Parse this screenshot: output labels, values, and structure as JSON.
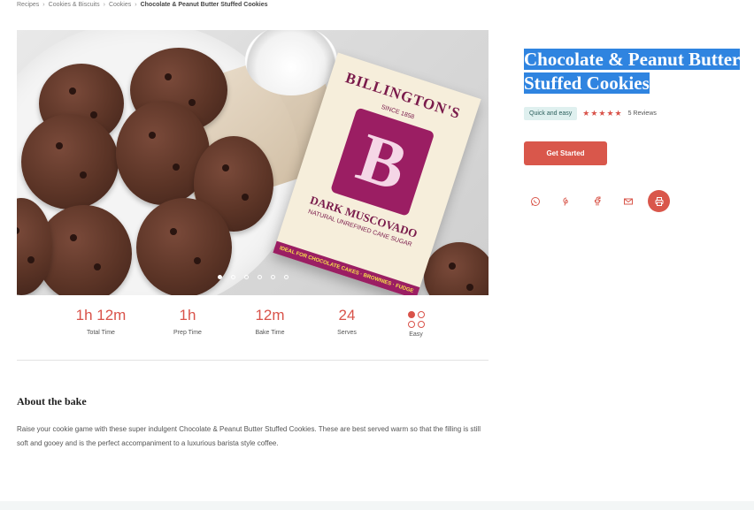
{
  "breadcrumb": {
    "items": [
      "Recipes",
      "Cookies & Biscuits",
      "Cookies"
    ],
    "current": "Chocolate & Peanut Butter Stuffed Cookies"
  },
  "hero": {
    "package": {
      "brand": "BILLINGTON'S",
      "since": "SINCE 1858",
      "letter": "B",
      "variety": "DARK MUSCOVADO",
      "sub": "NATURAL UNREFINED CANE SUGAR",
      "strip": "IDEAL FOR CHOCOLATE CAKES · BROWNIES · FUDGE"
    },
    "carousel": {
      "count": 6,
      "active_index": 0
    }
  },
  "stats": [
    {
      "value": "1h 12m",
      "label": "Total Time"
    },
    {
      "value": "1h",
      "label": "Prep Time"
    },
    {
      "value": "12m",
      "label": "Bake Time"
    },
    {
      "value": "24",
      "label": "Serves"
    },
    {
      "value": "",
      "label": "Easy",
      "icon": "difficulty-dots-icon"
    }
  ],
  "about": {
    "heading": "About the bake",
    "text": "Raise your cookie game with these super indulgent Chocolate & Peanut Butter Stuffed Cookies. These are best served warm so that the filling is still soft and gooey and is the perfect accompaniment to a luxurious barista style coffee."
  },
  "recipe": {
    "title": "Chocolate & Peanut Butter Stuffed Cookies",
    "badge": "Quick and easy",
    "rating": 5,
    "stars": "★★★★★",
    "reviews": "5 Reviews",
    "cta": "Get Started"
  },
  "share": {
    "icons": [
      "whatsapp-icon",
      "pinterest-icon",
      "facebook-icon",
      "email-icon",
      "print-icon"
    ]
  },
  "colors": {
    "accent": "#d9574b",
    "selection": "#2f84e0",
    "badge_bg": "#dff0ef"
  }
}
